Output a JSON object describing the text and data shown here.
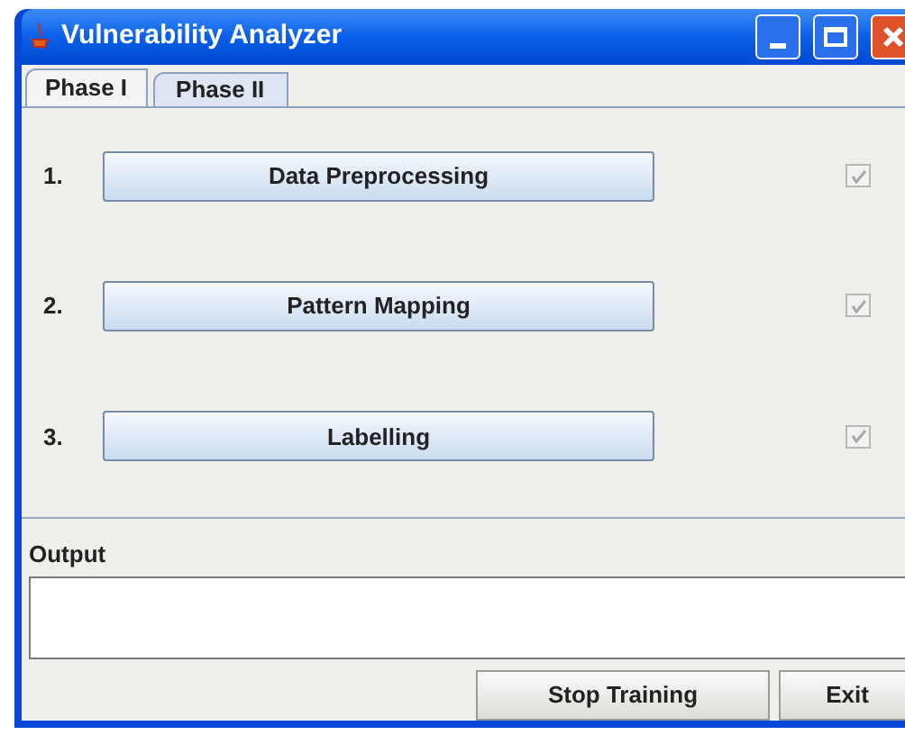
{
  "window": {
    "title": "Vulnerability Analyzer"
  },
  "tabs": [
    {
      "label": "Phase I",
      "selected": true
    },
    {
      "label": "Phase II",
      "selected": false
    }
  ],
  "steps": [
    {
      "number": "1.",
      "button": "Data Preprocessing",
      "checked": true,
      "disabled": true
    },
    {
      "number": "2.",
      "button": "Pattern Mapping",
      "checked": true,
      "disabled": true
    },
    {
      "number": "3.",
      "button": "Labelling",
      "checked": true,
      "disabled": true
    }
  ],
  "output": {
    "label": "Output"
  },
  "buttons": [
    "Stop Training",
    "Exit"
  ]
}
